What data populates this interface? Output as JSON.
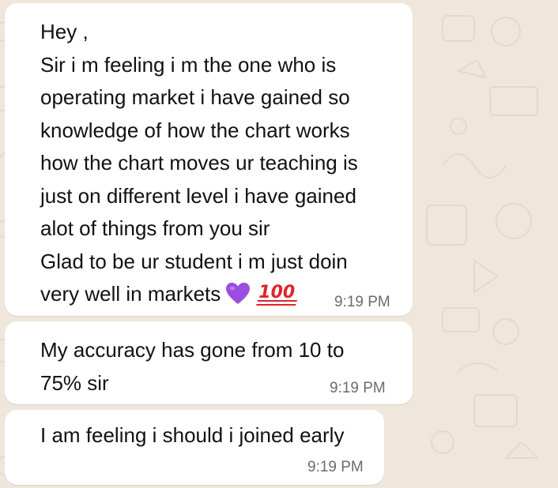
{
  "messages": [
    {
      "lines": [
        "Hey ,",
        "Sir i m feeling i m the one who is",
        "operating market i have gained so",
        "knowledge of how the chart works",
        "how the chart moves ur teaching is",
        "just on different level i have gained",
        "alot of things from you sir",
        "Glad to be ur student i m just doin",
        "very well in markets"
      ],
      "emojis": [
        "purple-heart",
        "hundred-points"
      ],
      "time": "9:19 PM"
    },
    {
      "lines": [
        "My accuracy has gone from 10 to",
        "75% sir"
      ],
      "time": "9:19 PM"
    },
    {
      "lines": [
        "I am feeling i should i joined early"
      ],
      "time": "9:19 PM"
    }
  ],
  "colors": {
    "wallpaper": "#efe7dc",
    "bubble": "#ffffff",
    "text": "#111111",
    "timestamp": "#6b6b6b",
    "heart": "#9b4de0",
    "hundred": "#e0232a"
  },
  "emoji_labels": {
    "hundred": "100"
  }
}
